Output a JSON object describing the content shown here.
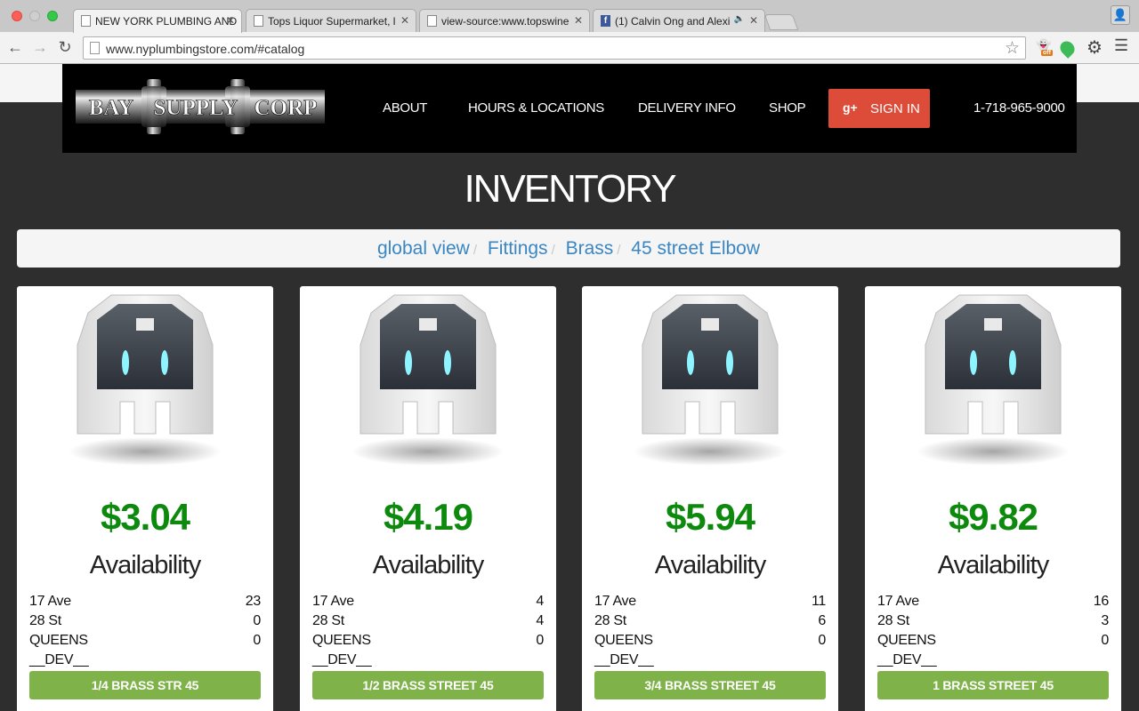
{
  "browser": {
    "tabs": [
      {
        "title": "NEW YORK PLUMBING AND"
      },
      {
        "title": "Tops Liquor Supermarket, l"
      },
      {
        "title": "view-source:www.topswine"
      },
      {
        "title": "(1) Calvin Ong and Alexi"
      }
    ],
    "url": "www.nyplumbingstore.com/#catalog",
    "ext_badge": "off"
  },
  "header": {
    "logo_words": [
      "BAY",
      "SUPPLY",
      "CORP"
    ],
    "nav": [
      "ABOUT",
      "HOURS & LOCATIONS",
      "DELIVERY INFO",
      "SHOP"
    ],
    "signin_icon": "g+",
    "signin_label": "SIGN IN",
    "phone": "1-718-965-9000"
  },
  "page_title": "INVENTORY",
  "breadcrumb": [
    "global view",
    "Fittings",
    "Brass",
    "45 street Elbow"
  ],
  "products": [
    {
      "price": "$3.04",
      "availability_label": "Availability",
      "stock": [
        {
          "loc": "17 Ave",
          "qty": "23"
        },
        {
          "loc": "28 St",
          "qty": "0"
        },
        {
          "loc": "QUEENS",
          "qty": "0"
        },
        {
          "loc": "__DEV__",
          "qty": ""
        }
      ],
      "button": "1/4 BRASS STR 45"
    },
    {
      "price": "$4.19",
      "availability_label": "Availability",
      "stock": [
        {
          "loc": "17 Ave",
          "qty": "4"
        },
        {
          "loc": "28 St",
          "qty": "4"
        },
        {
          "loc": "QUEENS",
          "qty": "0"
        },
        {
          "loc": "__DEV__",
          "qty": ""
        }
      ],
      "button": "1/2 BRASS STREET 45"
    },
    {
      "price": "$5.94",
      "availability_label": "Availability",
      "stock": [
        {
          "loc": "17 Ave",
          "qty": "11"
        },
        {
          "loc": "28 St",
          "qty": "6"
        },
        {
          "loc": "QUEENS",
          "qty": "0"
        },
        {
          "loc": "__DEV__",
          "qty": ""
        }
      ],
      "button": "3/4 BRASS STREET 45"
    },
    {
      "price": "$9.82",
      "availability_label": "Availability",
      "stock": [
        {
          "loc": "17 Ave",
          "qty": "16"
        },
        {
          "loc": "28 St",
          "qty": "3"
        },
        {
          "loc": "QUEENS",
          "qty": "0"
        },
        {
          "loc": "__DEV__",
          "qty": ""
        }
      ],
      "button": "1 BRASS STREET 45"
    }
  ],
  "colors": {
    "price": "#0d8a0d",
    "button": "#7fb34a",
    "signin": "#dd4b39",
    "breadcrumb_link": "#3a86c2"
  }
}
